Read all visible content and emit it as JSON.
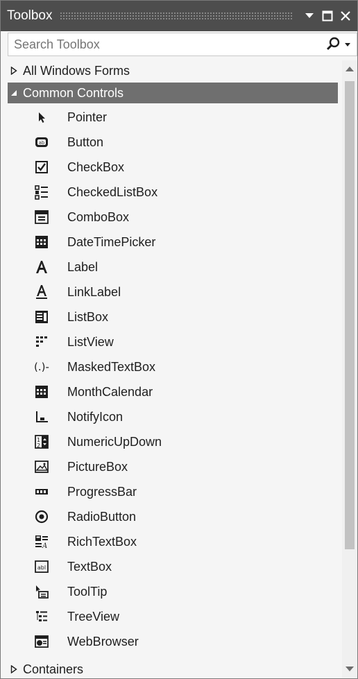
{
  "window": {
    "title": "Toolbox",
    "controls": [
      "dropdown-icon",
      "maximize-icon",
      "close-icon"
    ]
  },
  "search": {
    "placeholder": "Search Toolbox",
    "value": ""
  },
  "groups": {
    "all": {
      "label": "All Windows Forms",
      "expanded": false
    },
    "common": {
      "label": "Common Controls",
      "expanded": true
    },
    "containers": {
      "label": "Containers",
      "expanded": false
    }
  },
  "items": [
    {
      "label": "Pointer",
      "icon": "pointer-icon"
    },
    {
      "label": "Button",
      "icon": "button-icon"
    },
    {
      "label": "CheckBox",
      "icon": "checkbox-icon"
    },
    {
      "label": "CheckedListBox",
      "icon": "checkedlistbox-icon"
    },
    {
      "label": "ComboBox",
      "icon": "combobox-icon"
    },
    {
      "label": "DateTimePicker",
      "icon": "datetimepicker-icon"
    },
    {
      "label": "Label",
      "icon": "label-icon"
    },
    {
      "label": "LinkLabel",
      "icon": "linklabel-icon"
    },
    {
      "label": "ListBox",
      "icon": "listbox-icon"
    },
    {
      "label": "ListView",
      "icon": "listview-icon"
    },
    {
      "label": "MaskedTextBox",
      "icon": "maskedtextbox-icon"
    },
    {
      "label": "MonthCalendar",
      "icon": "monthcalendar-icon"
    },
    {
      "label": "NotifyIcon",
      "icon": "notifyicon-icon"
    },
    {
      "label": "NumericUpDown",
      "icon": "numericupdown-icon"
    },
    {
      "label": "PictureBox",
      "icon": "picturebox-icon"
    },
    {
      "label": "ProgressBar",
      "icon": "progressbar-icon"
    },
    {
      "label": "RadioButton",
      "icon": "radiobutton-icon"
    },
    {
      "label": "RichTextBox",
      "icon": "richtextbox-icon"
    },
    {
      "label": "TextBox",
      "icon": "textbox-icon"
    },
    {
      "label": "ToolTip",
      "icon": "tooltip-icon"
    },
    {
      "label": "TreeView",
      "icon": "treeview-icon"
    },
    {
      "label": "WebBrowser",
      "icon": "webbrowser-icon"
    }
  ],
  "colors": {
    "titlebar": "#4d4d4d",
    "selected_group": "#6f6f6f",
    "background": "#f5f5f5"
  }
}
